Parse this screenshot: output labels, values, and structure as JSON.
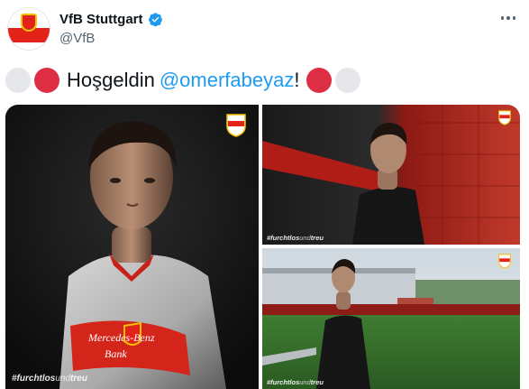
{
  "account": {
    "display_name": "VfB Stuttgart",
    "handle": "@VfB",
    "verified": true
  },
  "tweet": {
    "greeting": "Hoşgeldin",
    "mention": "@omerfabeyaz",
    "exclamation": "!",
    "emoji_leading": [
      "white-circle",
      "red-circle"
    ],
    "emoji_trailing": [
      "red-circle",
      "white-circle"
    ]
  },
  "media": {
    "hashtag_bold": "#furchtlos",
    "hashtag_light": "und",
    "hashtag_bold_end": "treu",
    "sponsor_text_line1": "Mercedes-Benz",
    "sponsor_text_line2": "Bank",
    "images": [
      {
        "id": "portrait-studio",
        "icon": "player-portrait"
      },
      {
        "id": "red-wall",
        "icon": "player-red-wall"
      },
      {
        "id": "stadium",
        "icon": "player-stadium"
      }
    ]
  },
  "colors": {
    "brand_red": "#e32219",
    "link_blue": "#1d9bf0",
    "muted": "#536471",
    "emoji_red": "#dd2e44",
    "emoji_white": "#e6e7ea"
  }
}
